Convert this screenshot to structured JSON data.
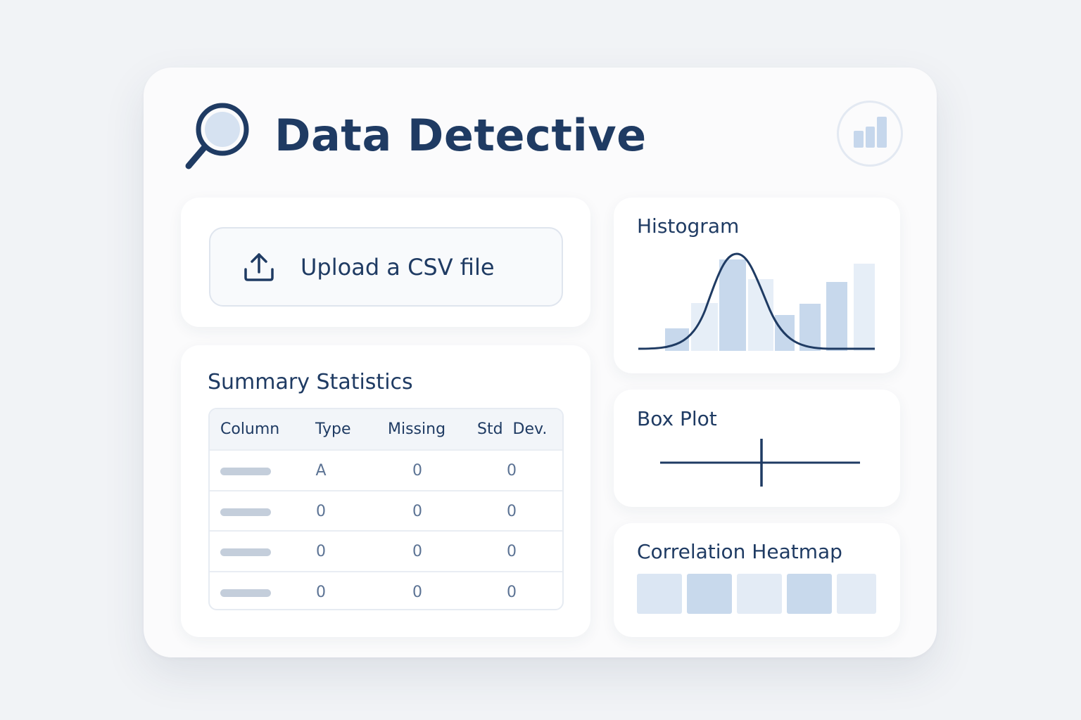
{
  "app": {
    "title": "Data Detective",
    "logo_icon": "magnifier-icon",
    "chart_button_icon": "bar-chart-icon"
  },
  "upload": {
    "label": "Upload a CSV file",
    "icon": "upload-icon"
  },
  "summary": {
    "title": "Summary Statistics",
    "columns": [
      "Column",
      "Type",
      "Missing",
      "Std  Dev."
    ],
    "rows": [
      {
        "type": "A",
        "missing": "0",
        "std": "0"
      },
      {
        "type": "0",
        "missing": "0",
        "std": "0"
      },
      {
        "type": "0",
        "missing": "0",
        "std": "0"
      },
      {
        "type": "0",
        "missing": "0",
        "std": "0"
      }
    ]
  },
  "histogram": {
    "title": "Histogram"
  },
  "boxplot": {
    "title": "Box Plot"
  },
  "heatmap": {
    "title": "Correlation Heatmap",
    "cells": [
      "#dbe6f3",
      "#c8d9ec",
      "#e3ebf5",
      "#c8d9ec",
      "#e3ebf5"
    ]
  },
  "colors": {
    "primary": "#1f3b63",
    "bar_dark": "#c7d8ec",
    "bar_light": "#e6eef7"
  }
}
